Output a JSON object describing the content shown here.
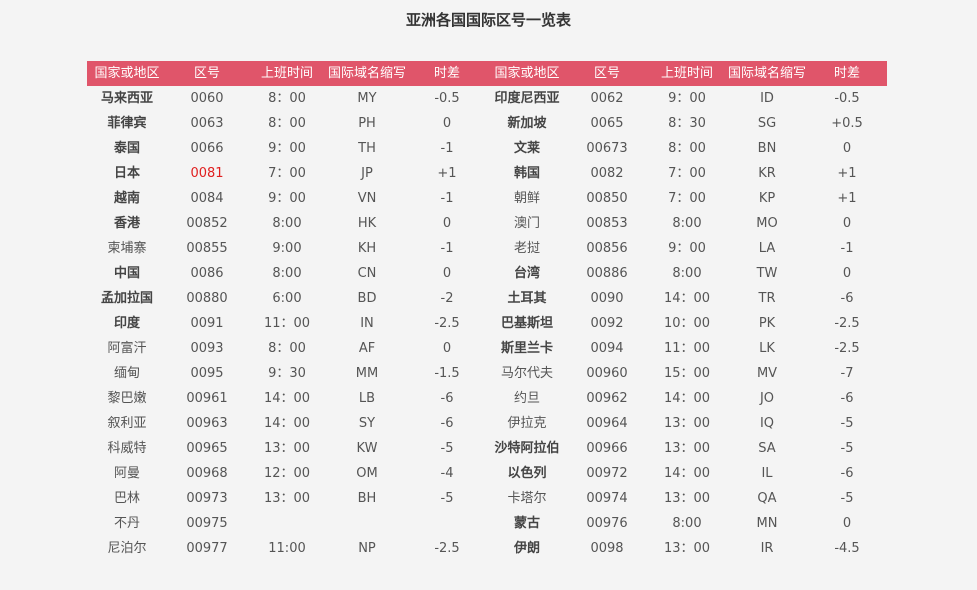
{
  "page": {
    "title": "亚洲各国国际区号一览表"
  },
  "table": {
    "headers": [
      "国家或地区",
      "区号",
      "上班时间",
      "国际域名缩写",
      "时差",
      "国家或地区",
      "区号",
      "上班时间",
      "国际域名缩写",
      "时差"
    ],
    "rows": [
      {
        "cells": [
          "马来西亚",
          "0060",
          "8：00",
          "MY",
          "-0.5",
          "印度尼西亚",
          "0062",
          "9：00",
          "ID",
          "-0.5"
        ],
        "bold": [
          0,
          5
        ],
        "red": []
      },
      {
        "cells": [
          "菲律宾",
          "0063",
          "8：00",
          "PH",
          "0",
          "新加坡",
          "0065",
          "8：30",
          "SG",
          "+0.5"
        ],
        "bold": [
          0,
          5
        ],
        "red": []
      },
      {
        "cells": [
          "泰国",
          "0066",
          "9：00",
          "TH",
          "-1",
          "文莱",
          "00673",
          "8：00",
          "BN",
          "0"
        ],
        "bold": [
          0,
          5
        ],
        "red": []
      },
      {
        "cells": [
          "日本",
          "0081",
          "7：00",
          "JP",
          "+1",
          "韩国",
          "0082",
          "7：00",
          "KR",
          "+1"
        ],
        "bold": [
          0,
          5
        ],
        "red": [
          1
        ]
      },
      {
        "cells": [
          "越南",
          "0084",
          "9：00",
          "VN",
          "-1",
          "朝鲜",
          "00850",
          "7：00",
          "KP",
          "+1"
        ],
        "bold": [
          0
        ],
        "red": []
      },
      {
        "cells": [
          "香港",
          "00852",
          "8:00",
          "HK",
          "0",
          "澳门",
          "00853",
          "8:00",
          "MO",
          "0"
        ],
        "bold": [
          0
        ],
        "red": []
      },
      {
        "cells": [
          "柬埔寨",
          "00855",
          "9:00",
          "KH",
          "-1",
          "老挝",
          "00856",
          "9：00",
          "LA",
          "-1"
        ],
        "bold": [],
        "red": []
      },
      {
        "cells": [
          "中国",
          "0086",
          "8:00",
          "CN",
          "0",
          "台湾",
          "00886",
          "8:00",
          "TW",
          "0"
        ],
        "bold": [
          0,
          5
        ],
        "red": []
      },
      {
        "cells": [
          "孟加拉国",
          "00880",
          "6:00",
          "BD",
          "-2",
          "土耳其",
          "0090",
          "14：00",
          "TR",
          "-6"
        ],
        "bold": [
          0,
          5
        ],
        "red": []
      },
      {
        "cells": [
          "印度",
          "0091",
          "11：00",
          "IN",
          "-2.5",
          "巴基斯坦",
          "0092",
          "10：00",
          "PK",
          "-2.5"
        ],
        "bold": [
          0,
          5
        ],
        "red": []
      },
      {
        "cells": [
          "阿富汗",
          "0093",
          "8：00",
          "AF",
          "0",
          "斯里兰卡",
          "0094",
          "11：00",
          "LK",
          "-2.5"
        ],
        "bold": [
          5
        ],
        "red": []
      },
      {
        "cells": [
          "缅甸",
          "0095",
          "9：30",
          "MM",
          "-1.5",
          "马尔代夫",
          "00960",
          "15：00",
          "MV",
          "-7"
        ],
        "bold": [],
        "red": []
      },
      {
        "cells": [
          "黎巴嫩",
          "00961",
          "14：00",
          "LB",
          "-6",
          "约旦",
          "00962",
          "14：00",
          "JO",
          "-6"
        ],
        "bold": [],
        "red": []
      },
      {
        "cells": [
          "叙利亚",
          "00963",
          "14：00",
          "SY",
          "-6",
          "伊拉克",
          "00964",
          "13：00",
          "IQ",
          "-5"
        ],
        "bold": [],
        "red": []
      },
      {
        "cells": [
          "科威特",
          "00965",
          "13：00",
          "KW",
          "-5",
          "沙特阿拉伯",
          "00966",
          "13：00",
          "SA",
          "-5"
        ],
        "bold": [
          5
        ],
        "red": []
      },
      {
        "cells": [
          "阿曼",
          "00968",
          "12：00",
          "OM",
          "-4",
          "以色列",
          "00972",
          "14：00",
          "IL",
          "-6"
        ],
        "bold": [
          5
        ],
        "red": []
      },
      {
        "cells": [
          "巴林",
          "00973",
          "13：00",
          "BH",
          "-5",
          "卡塔尔",
          "00974",
          "13：00",
          "QA",
          "-5"
        ],
        "bold": [],
        "red": []
      },
      {
        "cells": [
          "不丹",
          "00975",
          "",
          "",
          "",
          "蒙古",
          "00976",
          "8:00",
          "MN",
          "0"
        ],
        "bold": [
          5
        ],
        "red": []
      },
      {
        "cells": [
          "尼泊尔",
          "00977",
          "11:00",
          "NP",
          "-2.5",
          "伊朗",
          "0098",
          "13：00",
          "IR",
          "-4.5"
        ],
        "bold": [
          5
        ],
        "red": []
      }
    ]
  }
}
